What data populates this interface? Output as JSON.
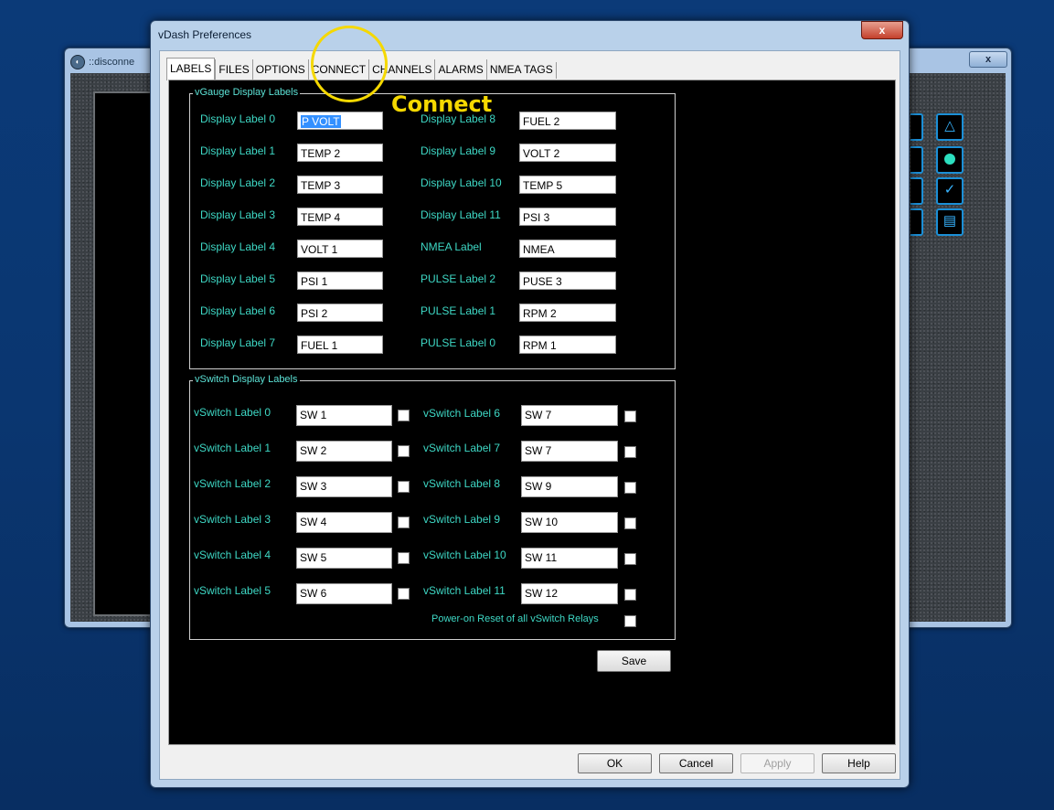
{
  "background_window": {
    "title": "::disconne",
    "close_label": "x",
    "side_buttons": [
      "up-arrow-icon",
      "circle-icon",
      "checkmark-icon",
      "document-icon"
    ]
  },
  "dialog": {
    "title": "vDash Preferences",
    "close_label": "x",
    "tabs": [
      "LABELS",
      "FILES",
      "OPTIONS",
      "CONNECT",
      "CHANNELS",
      "ALARMS",
      "NMEA TAGS"
    ],
    "active_tab": "LABELS",
    "gauge_group": {
      "title": "vGauge Display Labels",
      "left": [
        {
          "label": "Display Label 0",
          "value": "P VOLT"
        },
        {
          "label": "Display Label 1",
          "value": "TEMP 2"
        },
        {
          "label": "Display Label 2",
          "value": "TEMP 3"
        },
        {
          "label": "Display Label 3",
          "value": "TEMP 4"
        },
        {
          "label": "Display Label 4",
          "value": "VOLT 1"
        },
        {
          "label": "Display Label 5",
          "value": "PSI 1"
        },
        {
          "label": "Display Label 6",
          "value": "PSI 2"
        },
        {
          "label": "Display Label 7",
          "value": "FUEL 1"
        }
      ],
      "right": [
        {
          "label": "Display Label 8",
          "value": "FUEL 2"
        },
        {
          "label": "Display Label 9",
          "value": "VOLT 2"
        },
        {
          "label": "Display Label 10",
          "value": "TEMP 5"
        },
        {
          "label": "Display Label 11",
          "value": "PSI 3"
        },
        {
          "label": "NMEA Label",
          "value": "NMEA"
        },
        {
          "label": "PULSE Label 2",
          "value": "PUSE 3"
        },
        {
          "label": "PULSE Label 1",
          "value": "RPM 2"
        },
        {
          "label": "PULSE Label 0",
          "value": "RPM 1"
        }
      ]
    },
    "switch_group": {
      "title": "vSwitch Display Labels",
      "left": [
        {
          "label": "vSwitch Label 0",
          "value": "SW 1",
          "checked": false
        },
        {
          "label": "vSwitch Label 1",
          "value": "SW 2",
          "checked": false
        },
        {
          "label": "vSwitch Label 2",
          "value": "SW 3",
          "checked": false
        },
        {
          "label": "vSwitch Label 3",
          "value": "SW 4",
          "checked": false
        },
        {
          "label": "vSwitch Label 4",
          "value": "SW 5",
          "checked": false
        },
        {
          "label": "vSwitch Label 5",
          "value": "SW 6",
          "checked": false
        }
      ],
      "right": [
        {
          "label": "vSwitch Label 6",
          "value": "SW 7",
          "checked": false
        },
        {
          "label": "vSwitch Label 7",
          "value": "SW 7",
          "checked": false
        },
        {
          "label": "vSwitch Label 8",
          "value": "SW 9",
          "checked": false
        },
        {
          "label": "vSwitch Label 9",
          "value": "SW 10",
          "checked": false
        },
        {
          "label": "vSwitch Label 10",
          "value": "SW 11",
          "checked": false
        },
        {
          "label": "vSwitch Label 11",
          "value": "SW 12",
          "checked": false
        }
      ],
      "power_on_reset": {
        "label": "Power-on Reset of all vSwitch Relays",
        "checked": false
      }
    },
    "save_label": "Save",
    "footer": {
      "ok": "OK",
      "cancel": "Cancel",
      "apply": "Apply",
      "help": "Help"
    }
  },
  "annotation": {
    "text": "Connect",
    "color": "#f5d800"
  },
  "colors": {
    "label_text": "#3ed8c5",
    "panel_bg": "#000000",
    "desktop": "#0a3670",
    "highlight": "#f5d800"
  }
}
